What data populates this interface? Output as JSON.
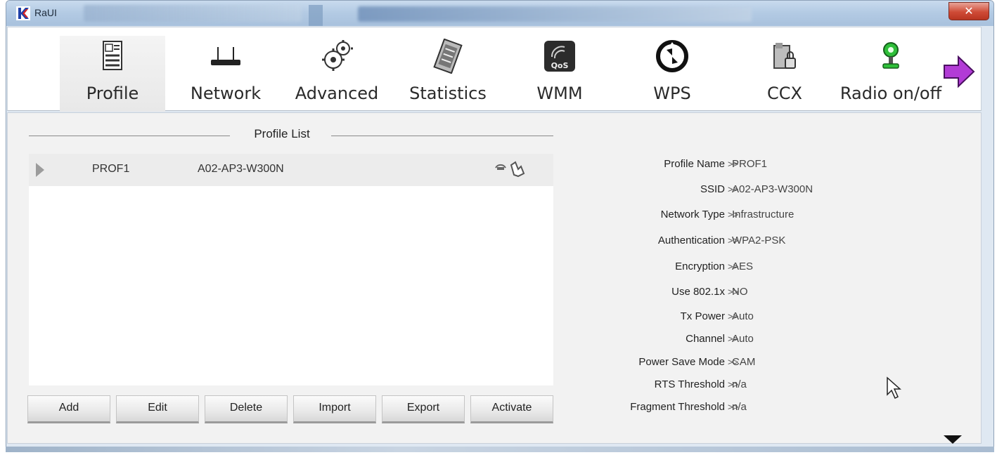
{
  "window": {
    "title": "RaUI",
    "close_label": "✕"
  },
  "toolbar": {
    "items": [
      {
        "label": "Profile",
        "icon": "profile-icon",
        "selected": true
      },
      {
        "label": "Network",
        "icon": "network-router-icon"
      },
      {
        "label": "Advanced",
        "icon": "gears-icon"
      },
      {
        "label": "Statistics",
        "icon": "statistics-icon"
      },
      {
        "label": "WMM",
        "icon": "qos-icon"
      },
      {
        "label": "WPS",
        "icon": "wps-icon"
      },
      {
        "label": "CCX",
        "icon": "ccx-lock-icon"
      },
      {
        "label": "Radio on/off",
        "icon": "radio-antenna-icon"
      }
    ],
    "next_icon": "arrow-right-icon"
  },
  "profile_list": {
    "title": "Profile List",
    "rows": [
      {
        "name": "PROF1",
        "ssid": "A02-AP3-W300N"
      }
    ]
  },
  "buttons": {
    "add": "Add",
    "edit": "Edit",
    "delete": "Delete",
    "import": "Import",
    "export": "Export",
    "activate": "Activate"
  },
  "details": {
    "separator": ">>",
    "rows": [
      {
        "key": "Profile Name",
        "value": "PROF1"
      },
      {
        "key": "SSID",
        "value": "A02-AP3-W300N"
      },
      {
        "key": "Network Type",
        "value": "Infrastructure"
      },
      {
        "key": "Authentication",
        "value": "WPA2-PSK"
      },
      {
        "key": "Encryption",
        "value": "AES"
      },
      {
        "key": "Use 802.1x",
        "value": "NO"
      },
      {
        "key": "Tx Power",
        "value": "Auto"
      },
      {
        "key": "Channel",
        "value": "Auto"
      },
      {
        "key": "Power Save Mode",
        "value": "CAM"
      },
      {
        "key": "RTS Threshold",
        "value": "n/a"
      },
      {
        "key": "Fragment Threshold",
        "value": "n/a"
      }
    ]
  },
  "colors": {
    "accent_purple": "#b23bd6",
    "radio_green": "#2fbf3a",
    "close_red": "#cf4b36"
  }
}
